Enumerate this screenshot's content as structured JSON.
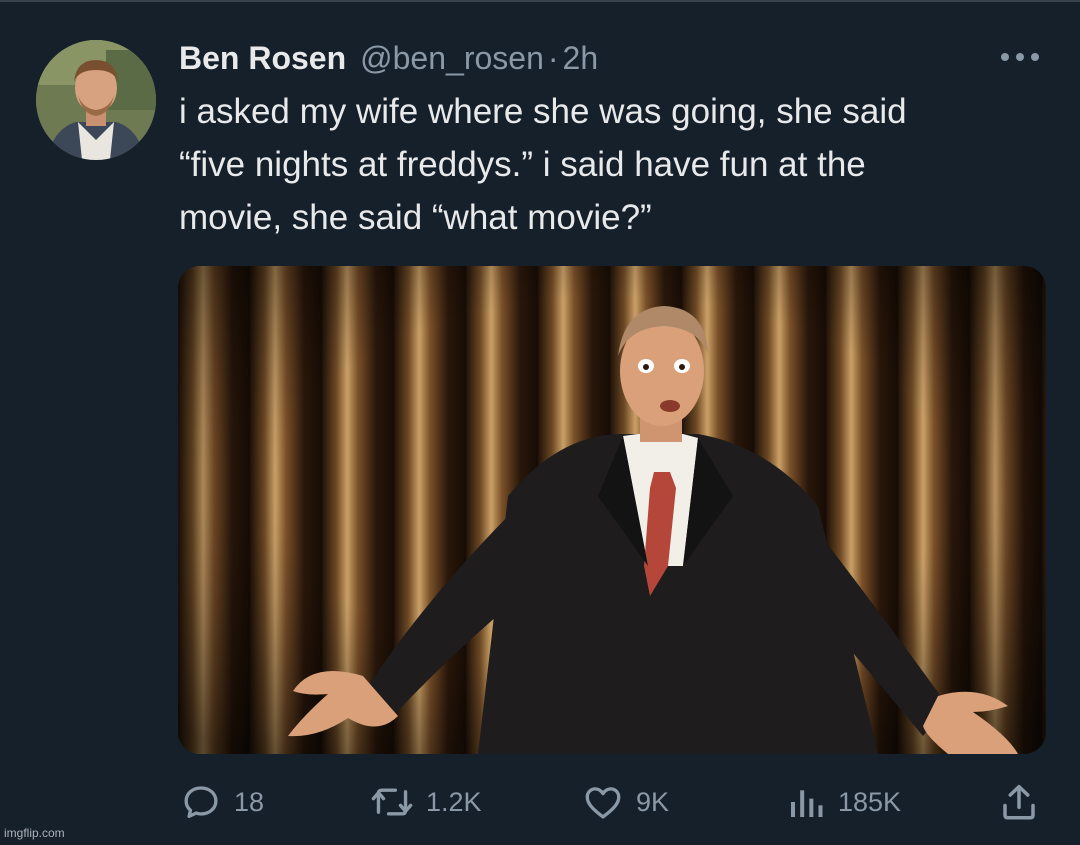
{
  "tweet": {
    "author_name": "Ben Rosen",
    "handle": "@ben_rosen",
    "separator": "·",
    "time": "2h",
    "text_lines": [
      "i asked my wife where she was going, she said",
      "“five nights at freddys.” i said have fun at the",
      "movie, she said “what movie?”"
    ]
  },
  "actions": {
    "replies": "18",
    "retweets": "1.2K",
    "likes": "9K",
    "views": "185K"
  },
  "icons": {
    "more": "more-horizontal-icon",
    "reply": "reply-bubble-icon",
    "retweet": "retweet-icon",
    "like": "heart-icon",
    "views": "bar-chart-icon",
    "share": "share-upload-icon"
  },
  "watermark": "imgflip.com",
  "colors": {
    "background": "#15202b",
    "primary_text": "#e7e9ea",
    "secondary_text": "#8b98a5"
  }
}
